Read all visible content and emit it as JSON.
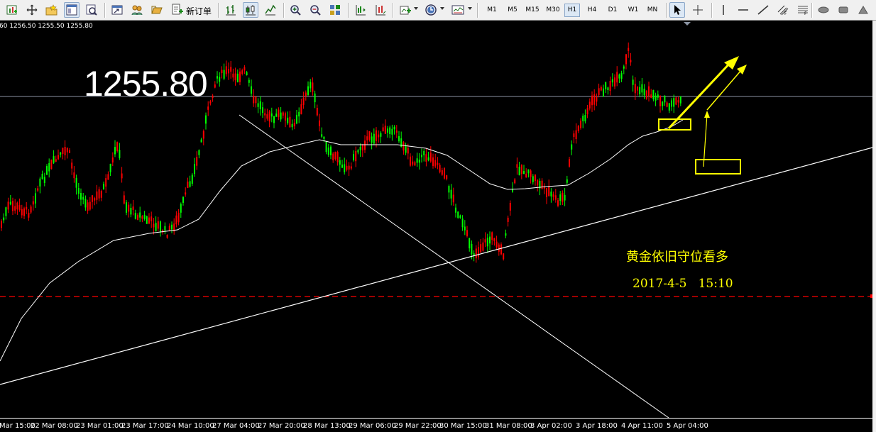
{
  "toolbar": {
    "new_order_label": "新订单",
    "timeframes": [
      {
        "label": "M1",
        "active": false
      },
      {
        "label": "M5",
        "active": false
      },
      {
        "label": "M15",
        "active": false
      },
      {
        "label": "M30",
        "active": false
      },
      {
        "label": "H1",
        "active": true
      },
      {
        "label": "H4",
        "active": false
      },
      {
        "label": "D1",
        "active": false
      },
      {
        "label": "W1",
        "active": false
      },
      {
        "label": "MN",
        "active": false
      }
    ]
  },
  "chart": {
    "ohlc_header": "60 1256.50 1255.50 1255.80",
    "big_price": "1255.80",
    "annotation_title": "黄金依旧守位看多",
    "annotation_date": "2017-4-5   15:10",
    "x_axis_labels": [
      "Mar 15:00",
      "22 Mar 08:00",
      "23 Mar 01:00",
      "23 Mar 17:00",
      "24 Mar 10:00",
      "27 Mar 04:00",
      "27 Mar 20:00",
      "28 Mar 13:00",
      "29 Mar 06:00",
      "29 Mar 22:00",
      "30 Mar 15:00",
      "31 Mar 08:00",
      "3 Apr 02:00",
      "3 Apr 18:00",
      "4 Apr 11:00",
      "5 Apr 04:00"
    ],
    "colors": {
      "background": "#000000",
      "bull_candle": "#00ff00",
      "bear_candle": "#ff0000",
      "moving_average": "#ffffff",
      "annotation": "#ffff00",
      "dashed_level": "#ff0000"
    }
  }
}
